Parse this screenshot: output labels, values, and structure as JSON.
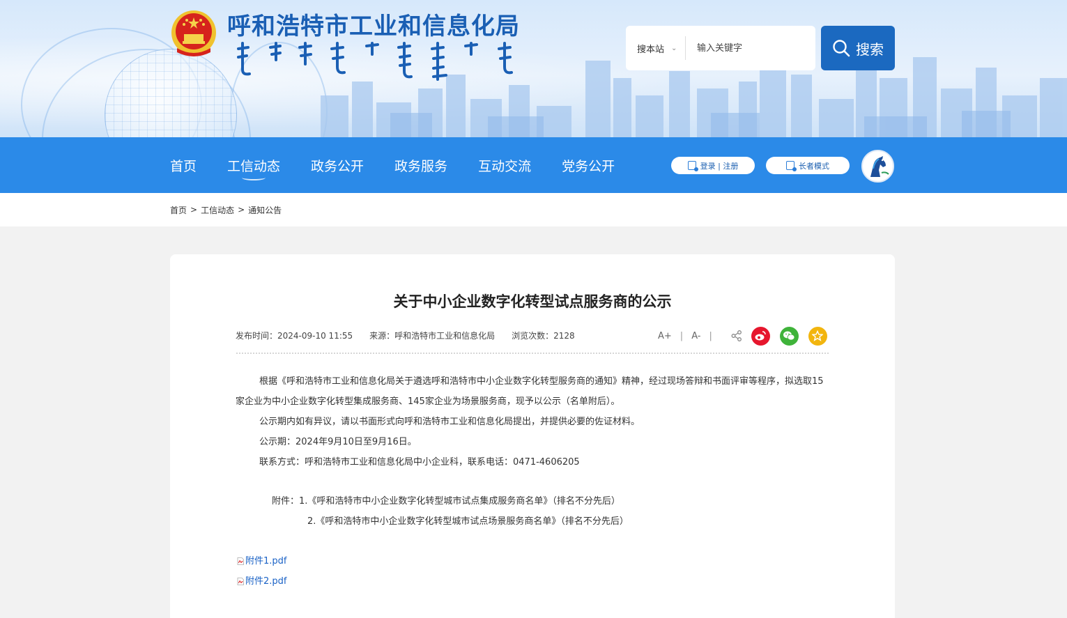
{
  "header": {
    "site_title": "呼和浩特市工业和信息化局",
    "search": {
      "scope_label": "搜本站",
      "placeholder": "输入关键字",
      "button_label": "搜索"
    }
  },
  "nav": {
    "items": [
      "首页",
      "工信动态",
      "政务公开",
      "政务服务",
      "互动交流",
      "党务公开"
    ],
    "active_index": 1,
    "login_label": "登录 | 注册",
    "elder_mode_label": "长者模式"
  },
  "breadcrumb": {
    "items": [
      "首页",
      "工信动态",
      "通知公告"
    ],
    "separator": ">"
  },
  "article": {
    "title": "关于中小企业数字化转型试点服务商的公示",
    "publish_time": "发布时间：2024-09-10 11:55",
    "source": "来源：呼和浩特市工业和信息化局",
    "views": "浏览次数：2128",
    "font_increase": "A+",
    "font_decrease": "A-",
    "tool_separator": "|",
    "paragraphs": [
      "根据《呼和浩特市工业和信息化局关于遴选呼和浩特市中小企业数字化转型服务商的通知》精神，经过现场答辩和书面评审等程序，拟选取15家企业为中小企业数字化转型集成服务商、145家企业为场景服务商，现予以公示（名单附后）。",
      "公示期内如有异议，请以书面形式向呼和浩特市工业和信息化局提出，并提供必要的佐证材料。",
      "公示期：2024年9月10日至9月16日。",
      "联系方式：呼和浩特市工业和信息化局中小企业科，联系电话：0471-4606205"
    ],
    "attachments_intro": [
      "附件：1.《呼和浩特市中小企业数字化转型城市试点集成服务商名单》（排名不分先后）",
      "2.《呼和浩特市中小企业数字化转型城市试点场景服务商名单》（排名不分先后）"
    ],
    "files": [
      "附件1.pdf",
      "附件2.pdf"
    ]
  },
  "colors": {
    "nav_blue": "#2b8ae8",
    "title_blue": "#1a5fb4",
    "search_button": "#1b69c0",
    "link_blue": "#1a62c6",
    "weibo_red": "#e6162d",
    "wechat_green": "#3fb33a",
    "favorite_yellow": "#f2b50e"
  }
}
